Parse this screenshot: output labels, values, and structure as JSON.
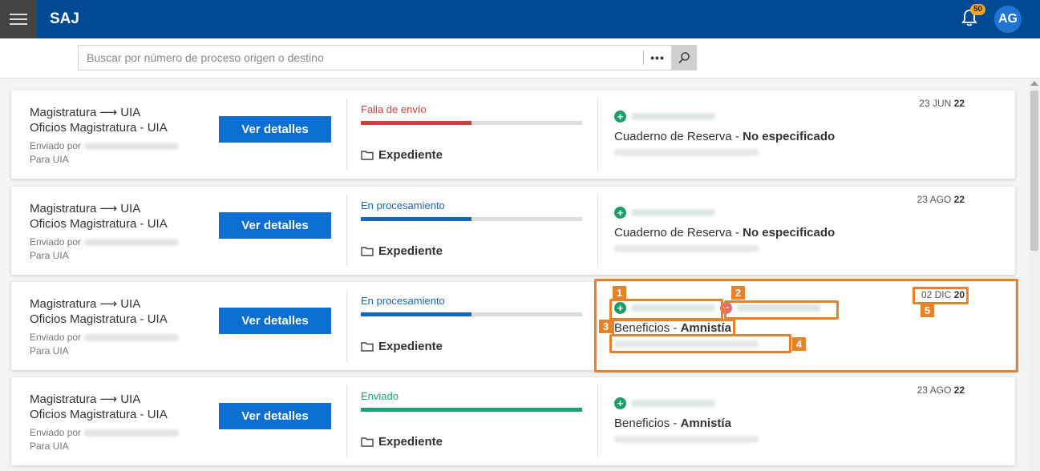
{
  "app": {
    "brand": "SAJ",
    "notification_count": "50",
    "user_initials": "AG"
  },
  "search": {
    "placeholder": "Buscar por número de proceso origen o destino",
    "more_label": "•••"
  },
  "records": [
    {
      "route": "Magistratura ⟶ UIA",
      "office": "Oficios Magistratura - UIA",
      "sent_by_label": "Enviado por",
      "recipient": "Para UIA",
      "action_label": "Ver detalles",
      "status": "Falla de envío",
      "status_color": "#d93b3b",
      "progress": 0.5,
      "folder_label": "Expediente",
      "notebook": "Cuaderno de Reserva",
      "notebook_sep": " - ",
      "notebook_value": "No especificado",
      "date_prefix": "23 JUN",
      "date_year": "22",
      "has_removed_party": false
    },
    {
      "route": "Magistratura ⟶ UIA",
      "office": "Oficios Magistratura - UIA",
      "sent_by_label": "Enviado por",
      "recipient": "Para UIA",
      "action_label": "Ver detalles",
      "status": "En procesamiento",
      "status_color": "#1565b8",
      "progress": 0.5,
      "folder_label": "Expediente",
      "notebook": "Cuaderno de Reserva",
      "notebook_sep": " - ",
      "notebook_value": "No especificado",
      "date_prefix": "23 AGO",
      "date_year": "22",
      "has_removed_party": false
    },
    {
      "route": "Magistratura ⟶ UIA",
      "office": "Oficios Magistratura - UIA",
      "sent_by_label": "Enviado por",
      "recipient": "Para UIA",
      "action_label": "Ver detalles",
      "status": "En procesamiento",
      "status_color": "#1565b8",
      "progress": 0.5,
      "folder_label": "Expediente",
      "notebook": "Beneficios",
      "notebook_sep": " - ",
      "notebook_value": "Amnistía",
      "date_prefix": "02 DIC",
      "date_year": "20",
      "has_removed_party": true
    },
    {
      "route": "Magistratura ⟶ UIA",
      "office": "Oficios Magistratura - UIA",
      "sent_by_label": "Enviado por",
      "recipient": "Para UIA",
      "action_label": "Ver detalles",
      "status": "Enviado",
      "status_color": "#17a27a",
      "progress": 1.0,
      "folder_label": "Expediente",
      "notebook": "Beneficios",
      "notebook_sep": " - ",
      "notebook_value": "Amnistía",
      "date_prefix": "23 AGO",
      "date_year": "22",
      "has_removed_party": false
    }
  ],
  "annotations": [
    "1",
    "2",
    "3",
    "4",
    "5"
  ],
  "colors": {
    "topbar": "#004a93",
    "accent": "#0a6fd0",
    "annotation": "#e8822a"
  }
}
